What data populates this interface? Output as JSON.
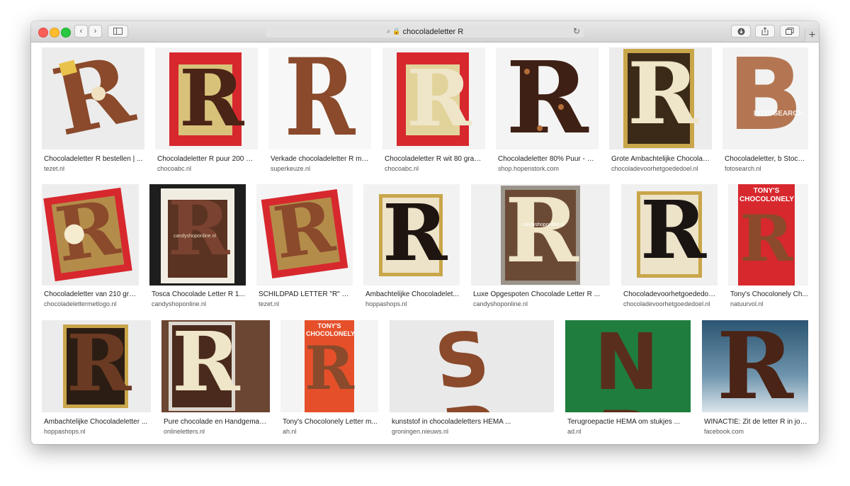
{
  "browser": {
    "address": "chocoladeletter R",
    "new_tab": "+"
  },
  "results": [
    {
      "caption": "Chocoladeletter R bestellen | ...",
      "source": "tezet.nl",
      "letter": "R"
    },
    {
      "caption": "Chocoladeletter R puur 200 gr...",
      "source": "chocoabc.nl",
      "letter": "R"
    },
    {
      "caption": "Verkade chocoladeletter R mel...",
      "source": "superkeuze.nl",
      "letter": "R"
    },
    {
      "caption": "Chocoladeletter R wit 80 gram...",
      "source": "chocoabc.nl",
      "letter": "R"
    },
    {
      "caption": "Chocoladeletter 80% Puur - Ho...",
      "source": "shop.hopenstork.com",
      "letter": "R"
    },
    {
      "caption": "Grote Ambachtelijke Chocolad...",
      "source": "chocoladevoorhetgoededoel.nl",
      "letter": "R"
    },
    {
      "caption": "Chocoladeletter, b Stock ...",
      "source": "fotosearch.nl",
      "letter": "B",
      "watermark": "FOTOSEARCH"
    },
    {
      "caption": "Chocoladeletter van 210 gra...",
      "source": "chocoladelettermetlogo.nl",
      "letter": "R"
    },
    {
      "caption": "Tosca Chocolade Letter R 1...",
      "source": "candyshoponline.nl",
      "letter": "R",
      "watermark": "candyshoponline.nl"
    },
    {
      "caption": "SCHILDPAD LETTER \"R\" ME...",
      "source": "tezet.nl",
      "letter": "R"
    },
    {
      "caption": "Ambachtelijke Chocoladelet...",
      "source": "hoppashops.nl",
      "letter": "R"
    },
    {
      "caption": "Luxe Opgespoten Chocolade Letter R ...",
      "source": "candyshoponline.nl",
      "letter": "R",
      "watermark": "candyshoponline.nl"
    },
    {
      "caption": "Chocoladevoorhetgoededoe...",
      "source": "chocoladevoorhetgoededoel.nl",
      "letter": "R"
    },
    {
      "caption": "Tony's Chocolonely Ch...",
      "source": "natuurvol.nl",
      "letter": "R",
      "brand": "TONY'S CHOCOLONELY"
    },
    {
      "caption": "Ambachtelijke Chocoladeletter ...",
      "source": "hoppashops.nl",
      "letter": "R"
    },
    {
      "caption": "Pure chocolade en Handgemaak...",
      "source": "onlineletters.nl",
      "letter": "R"
    },
    {
      "caption": "Tony's Chocolonely Letter m...",
      "source": "ah.nl",
      "letter": "R",
      "brand": "TONY'S CHOCOLONELY"
    },
    {
      "caption": "kunststof in chocoladeletters HEMA ...",
      "source": "groningen.nieuws.nl",
      "letter": "S P"
    },
    {
      "caption": "Terugroepactie HEMA om stukjes ...",
      "source": "ad.nl",
      "letter": "N R"
    },
    {
      "caption": "WINACTIE: Zit de letter R in jou...",
      "source": "facebook.com",
      "letter": "R"
    }
  ],
  "colors": {
    "milk": "#8a4a2b",
    "dark": "#4a2416",
    "white_choc": "#efe5c8",
    "red_box": "#d7282e",
    "gold": "#c9a64a"
  }
}
